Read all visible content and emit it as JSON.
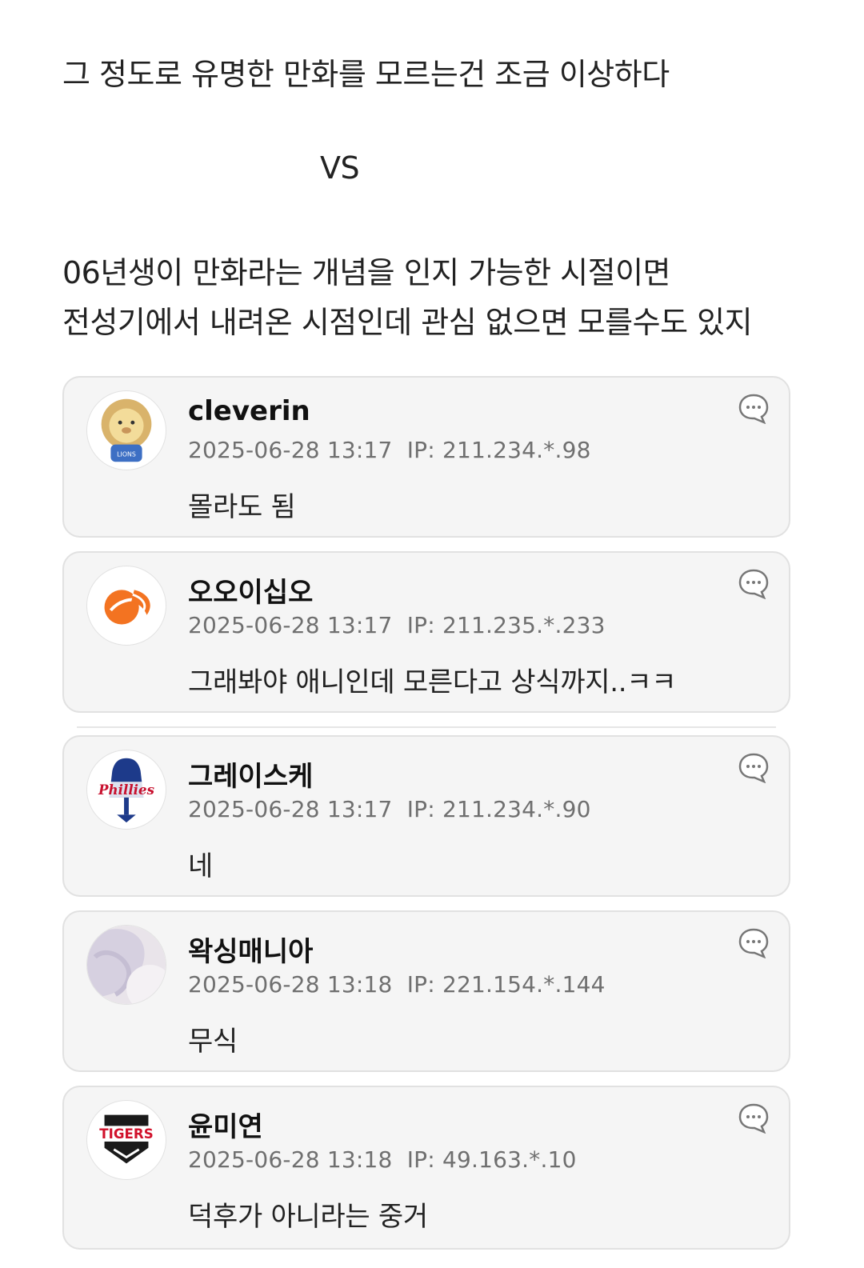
{
  "post": {
    "line1": "그 정도로 유명한 만화를 모르는건 조금 이상하다",
    "vs": "VS",
    "line3": "06년생이 만화라는 개념을 인지 가능한 시절이면",
    "line4": "전성기에서 내려온 시점인데 관심 없으면 모를수도 있지"
  },
  "comments": [
    {
      "nick": "cleverin",
      "date": "2025-06-28 13:17",
      "ip": "IP: 211.234.*.98",
      "text": "몰라도 됨",
      "avatar_icon": "lion-mascot-icon"
    },
    {
      "nick": "오오이십오",
      "date": "2025-06-28 13:17",
      "ip": "IP: 211.235.*.233",
      "text": "그래봐야 애니인데 모른다고 상식까지..ㅋㅋ",
      "avatar_icon": "eagles-logo-icon"
    },
    {
      "nick": "그레이스케",
      "date": "2025-06-28 13:17",
      "ip": "IP: 211.234.*.90",
      "text": "네",
      "avatar_icon": "phillies-logo-icon"
    },
    {
      "nick": "왁싱매니아",
      "date": "2025-06-28 13:18",
      "ip": "IP: 221.154.*.144",
      "text": "무식",
      "avatar_icon": "photo-avatar-icon"
    },
    {
      "nick": "윤미연",
      "date": "2025-06-28 13:18",
      "ip": "IP: 49.163.*.10",
      "text": "덕후가 아니라는 중거",
      "avatar_icon": "tigers-logo-icon",
      "logo_text": "TIGERS"
    }
  ],
  "colors": {
    "card_bg": "#f5f5f5",
    "card_border": "#e1e1e1",
    "meta_text": "#6f6f6f"
  }
}
